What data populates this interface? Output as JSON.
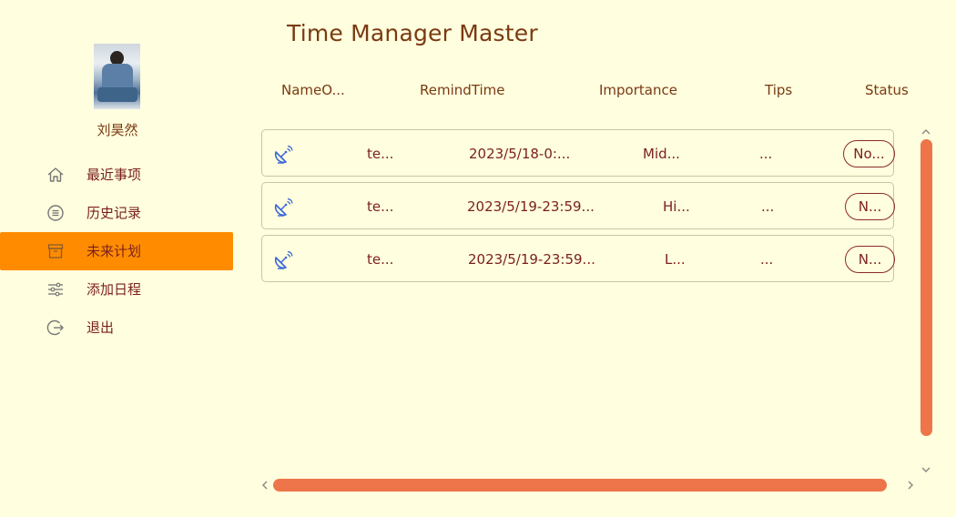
{
  "app": {
    "title": "Time Manager Master"
  },
  "user": {
    "name": "刘昊然"
  },
  "nav": {
    "items": [
      {
        "label": "最近事项",
        "icon": "home-icon"
      },
      {
        "label": "历史记录",
        "icon": "list-circle-icon"
      },
      {
        "label": "未来计划",
        "icon": "archive-icon",
        "active": true
      },
      {
        "label": "添加日程",
        "icon": "sliders-icon"
      },
      {
        "label": "退出",
        "icon": "logout-icon"
      }
    ]
  },
  "table": {
    "headers": {
      "name": "NameO...",
      "remind_time": "RemindTime",
      "importance": "Importance",
      "tips": "Tips",
      "status": "Status"
    },
    "rows": [
      {
        "icon": "satellite-dish-icon",
        "name": "te...",
        "remind_time": "2023/5/18-0:...",
        "importance": "Mid...",
        "tips": "...",
        "status": "No..."
      },
      {
        "icon": "satellite-dish-icon",
        "name": "te...",
        "remind_time": "2023/5/19-23:59...",
        "importance": "Hi...",
        "tips": "...",
        "status": "N..."
      },
      {
        "icon": "satellite-dish-icon",
        "name": "te...",
        "remind_time": "2023/5/19-23:59...",
        "importance": "L...",
        "tips": "...",
        "status": "N..."
      }
    ]
  },
  "scrollbar": {
    "up": "⌃",
    "down": "⌄",
    "left": "‹",
    "right": "›"
  },
  "colors": {
    "background": "#FFFEDE",
    "accent": "#FF8C00",
    "scrollbar": "#EE7549",
    "text": "#7A1F1F",
    "icon_blue": "#3A66D6"
  }
}
